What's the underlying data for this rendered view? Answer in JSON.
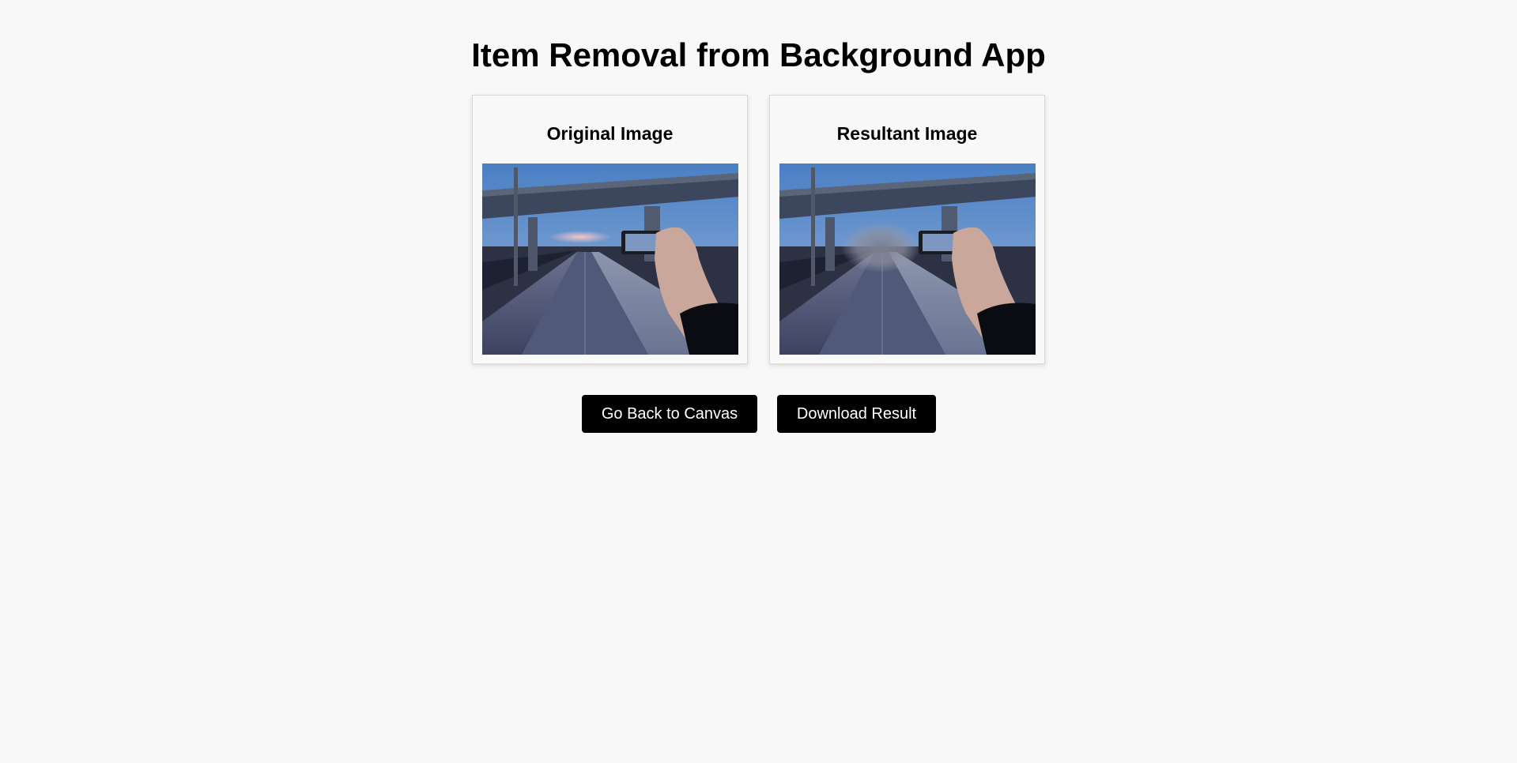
{
  "app": {
    "title": "Item Removal from Background App"
  },
  "panels": {
    "original": {
      "title": "Original Image",
      "image_alt": "Original Image"
    },
    "result": {
      "title": "Resultant Image",
      "image_alt": "Resultant Image"
    }
  },
  "actions": {
    "back_label": "Go Back to Canvas",
    "download_label": "Download Result"
  },
  "colors": {
    "page_background": "#f8f8f8",
    "button_background": "#000000",
    "button_text": "#ffffff"
  }
}
